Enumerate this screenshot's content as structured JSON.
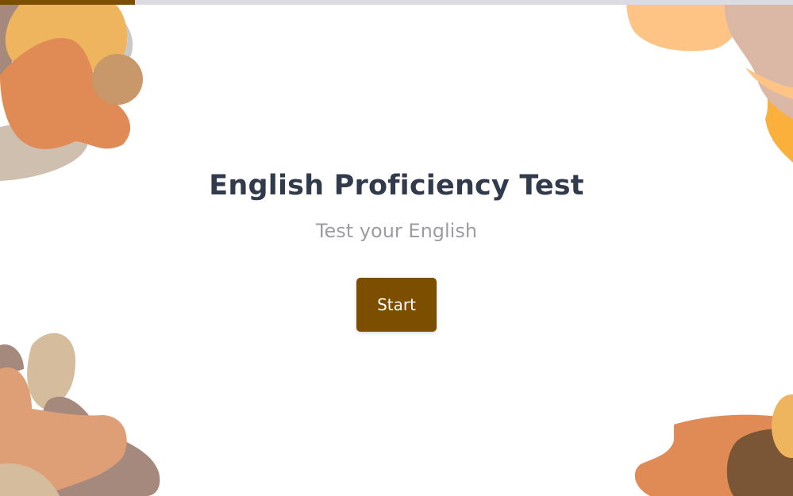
{
  "progress": {
    "value": 0.17,
    "fill_color": "#7b4e00",
    "track_color": "#dcdbe2"
  },
  "title": "English Proficiency Test",
  "subtitle": "Test your English",
  "start_button": {
    "label": "Start",
    "color": "#7b4e00"
  },
  "decorations": {
    "palette": [
      "#eeb55e",
      "#e08b55",
      "#c8976a",
      "#cfbfae",
      "#a5897c",
      "#d5bc9d",
      "#fdc486",
      "#dbb8a6",
      "#fbb03b",
      "#7a5636",
      "#de9f77",
      "#c9c9c9"
    ]
  }
}
